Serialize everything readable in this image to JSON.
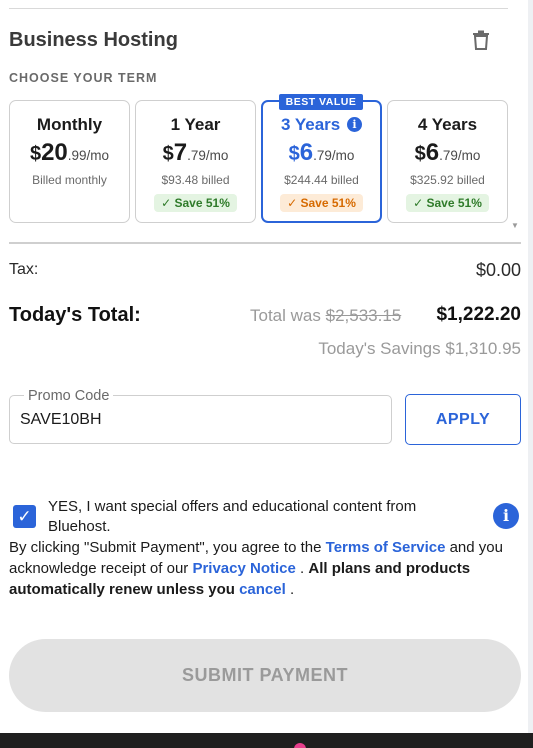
{
  "product": {
    "title": "Business Hosting"
  },
  "term_section": {
    "label": "CHOOSE YOUR TERM",
    "best_value_badge": "BEST VALUE",
    "cards": [
      {
        "name": "Monthly",
        "currency": "$",
        "whole": "20",
        "cents": ".99/mo",
        "billed": "Billed monthly",
        "save": ""
      },
      {
        "name": "1 Year",
        "currency": "$",
        "whole": "7",
        "cents": ".79/mo",
        "billed": "$93.48 billed",
        "save": "Save 51%"
      },
      {
        "name": "3 Years",
        "currency": "$",
        "whole": "6",
        "cents": ".79/mo",
        "billed": "$244.44 billed",
        "save": "Save 51%",
        "selected": true
      },
      {
        "name": "4 Years",
        "currency": "$",
        "whole": "6",
        "cents": ".79/mo",
        "billed": "$325.92 billed",
        "save": "Save 51%"
      }
    ]
  },
  "summary": {
    "tax_label": "Tax:",
    "tax_value": "$0.00",
    "total_label": "Today's Total:",
    "total_was_prefix": "Total was",
    "total_was_value": "$2,533.15",
    "total_value": "$1,222.20",
    "savings": "Today's Savings $1,310.95"
  },
  "promo": {
    "label": "Promo Code",
    "value": "SAVE10BH",
    "apply_label": "APPLY"
  },
  "optin": {
    "checked": true,
    "text": "YES, I want special offers and educational content from Bluehost."
  },
  "legal": {
    "part1": "By clicking \"Submit Payment\", you agree to the ",
    "terms_link": "Terms of Service",
    "part2": " and you acknowledge receipt of our ",
    "privacy_link": "Privacy Notice",
    "part3": " .  ",
    "bold_text": "All plans and products automatically renew unless you ",
    "cancel_link": "cancel",
    "part4": " ."
  },
  "submit": {
    "label": "SUBMIT PAYMENT"
  },
  "colors": {
    "accent": "#2b64d9",
    "save_green": "#2f7b2a",
    "save_orange": "#d66a00",
    "disabled": "#e2e2e2"
  }
}
